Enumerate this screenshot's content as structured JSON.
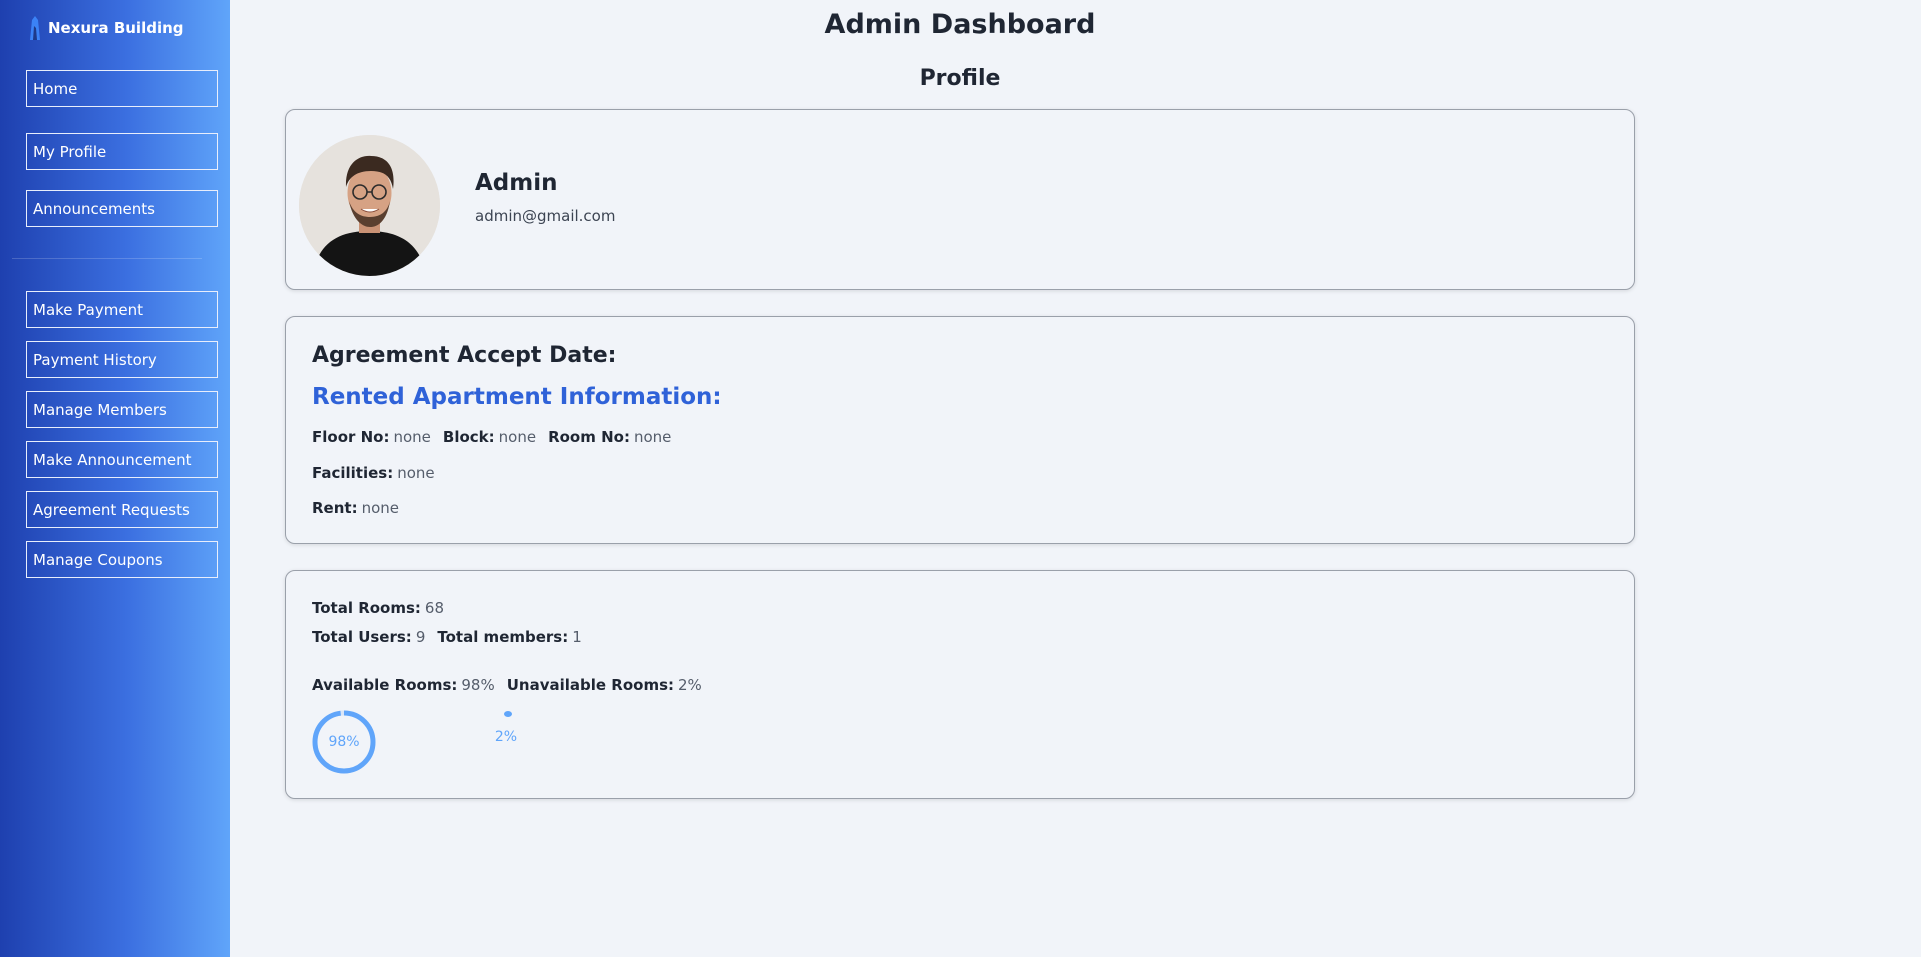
{
  "brand": {
    "name": "Nexura Building",
    "icon": "building-logo-icon"
  },
  "sidebar": {
    "items": [
      {
        "label": "Home"
      },
      {
        "label": "My Profile"
      },
      {
        "label": "Announcements"
      },
      {
        "label": "Make Payment"
      },
      {
        "label": "Payment History"
      },
      {
        "label": "Manage Members"
      },
      {
        "label": "Make Announcement"
      },
      {
        "label": "Agreement Requests"
      },
      {
        "label": "Manage Coupons"
      }
    ]
  },
  "main": {
    "title": "Admin Dashboard",
    "section_title": "Profile",
    "profile": {
      "name": "Admin",
      "email": "admin@gmail.com"
    },
    "agreement": {
      "title": "Agreement Accept Date:",
      "subtitle": "Rented Apartment Information:",
      "floor_label": "Floor No:",
      "floor_value": "none",
      "block_label": "Block:",
      "block_value": "none",
      "room_label": "Room No:",
      "room_value": "none",
      "facilities_label": "Facilities:",
      "facilities_value": "none",
      "rent_label": "Rent:",
      "rent_value": "none"
    },
    "stats": {
      "total_rooms_label": "Total Rooms:",
      "total_rooms_value": "68",
      "total_users_label": "Total Users:",
      "total_users_value": "9",
      "total_members_label": "Total members:",
      "total_members_value": "1",
      "available_label": "Available Rooms:",
      "available_value": "98%",
      "unavailable_label": "Unavailable Rooms:",
      "unavailable_value": "2%",
      "available_fraction": 0.98,
      "unavailable_fraction": 0.02,
      "ring_color": "#60a5fa"
    }
  },
  "colors": {
    "accent": "#2f62d8",
    "sidebar_start": "#1e40af",
    "sidebar_end": "#60a5fa"
  }
}
